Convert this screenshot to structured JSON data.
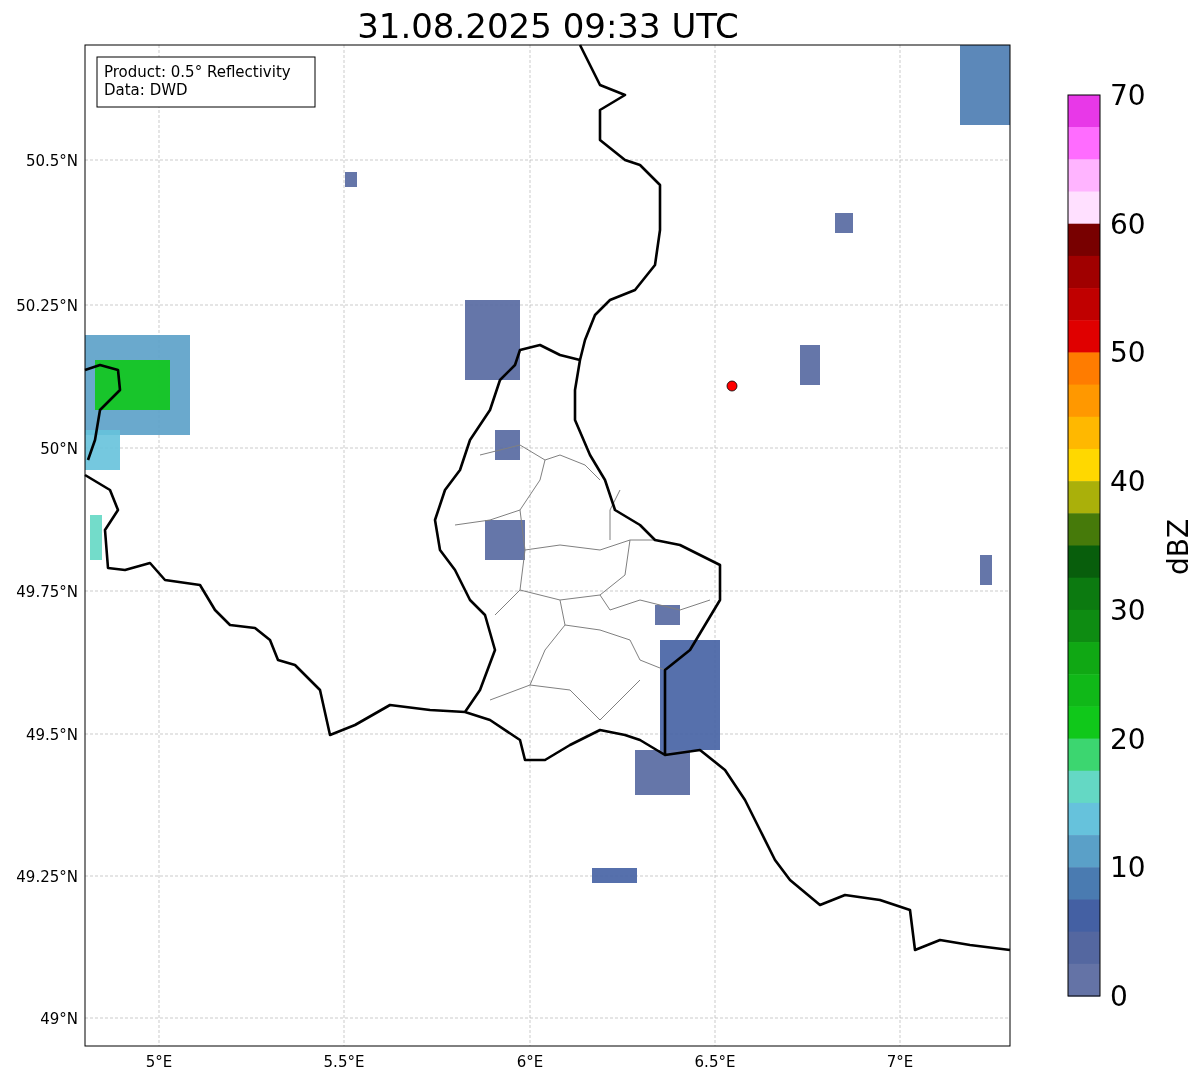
{
  "title": "31.08.2025 09:33 UTC",
  "info_box": {
    "lines": [
      "Product: 0.5° Reflectivity",
      "Data: DWD"
    ]
  },
  "y_axis": {
    "labels": [
      "50.5°N",
      "50.25°N",
      "50°N",
      "49.75°N",
      "49.5°N",
      "49.25°N",
      "49°N"
    ]
  },
  "x_axis": {
    "labels": [
      "5°E",
      "5.5°E",
      "6°E",
      "6.5°E",
      "7°E"
    ]
  },
  "colorbar": {
    "label": "dBZ",
    "ticks": [
      "70",
      "60",
      "50",
      "40",
      "30",
      "20",
      "10",
      "0"
    ],
    "segments": [
      {
        "color": "#e838e8"
      },
      {
        "color": "#ff6cff"
      },
      {
        "color": "#ffb4ff"
      },
      {
        "color": "#ffe0ff"
      },
      {
        "color": "#780000"
      },
      {
        "color": "#a00000"
      },
      {
        "color": "#c00000"
      },
      {
        "color": "#e00000"
      },
      {
        "color": "#ff7c00"
      },
      {
        "color": "#ff9800"
      },
      {
        "color": "#ffb800"
      },
      {
        "color": "#ffd800"
      },
      {
        "color": "#aab00a"
      },
      {
        "color": "#467a0a"
      },
      {
        "color": "#085e0c"
      },
      {
        "color": "#0c7a10"
      },
      {
        "color": "#0e8c12"
      },
      {
        "color": "#10a814"
      },
      {
        "color": "#10b818"
      },
      {
        "color": "#10c81a"
      },
      {
        "color": "#3cd670"
      },
      {
        "color": "#64d8c4"
      },
      {
        "color": "#66c2dc"
      },
      {
        "color": "#5aa0c8"
      },
      {
        "color": "#4a7bb1"
      },
      {
        "color": "#4460a3"
      },
      {
        "color": "#5467a0"
      },
      {
        "color": "#6473a6"
      }
    ]
  }
}
